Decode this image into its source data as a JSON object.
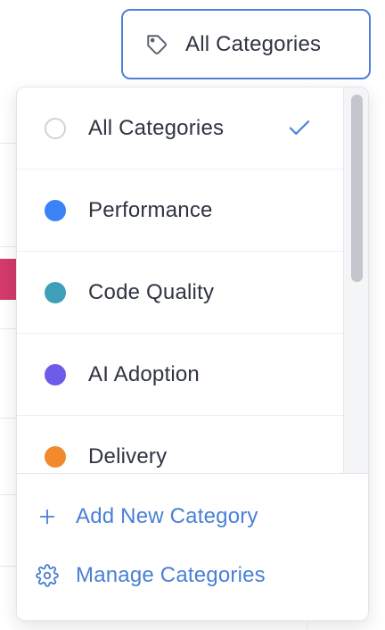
{
  "filter": {
    "selected_label": "All Categories",
    "icon": "tag-icon"
  },
  "dropdown": {
    "items": [
      {
        "label": "All Categories",
        "color": null,
        "selected": true
      },
      {
        "label": "Performance",
        "color": "#3b82f6",
        "selected": false
      },
      {
        "label": "Code Quality",
        "color": "#3f9fb8",
        "selected": false
      },
      {
        "label": "AI Adoption",
        "color": "#6c5ce7",
        "selected": false
      },
      {
        "label": "Delivery",
        "color": "#f08a2c",
        "selected": false
      }
    ],
    "actions": {
      "add_label": "Add New Category",
      "manage_label": "Manage Categories"
    }
  },
  "colors": {
    "accent": "#4f80dc",
    "link": "#4a7fd6",
    "text": "#2f3441"
  }
}
